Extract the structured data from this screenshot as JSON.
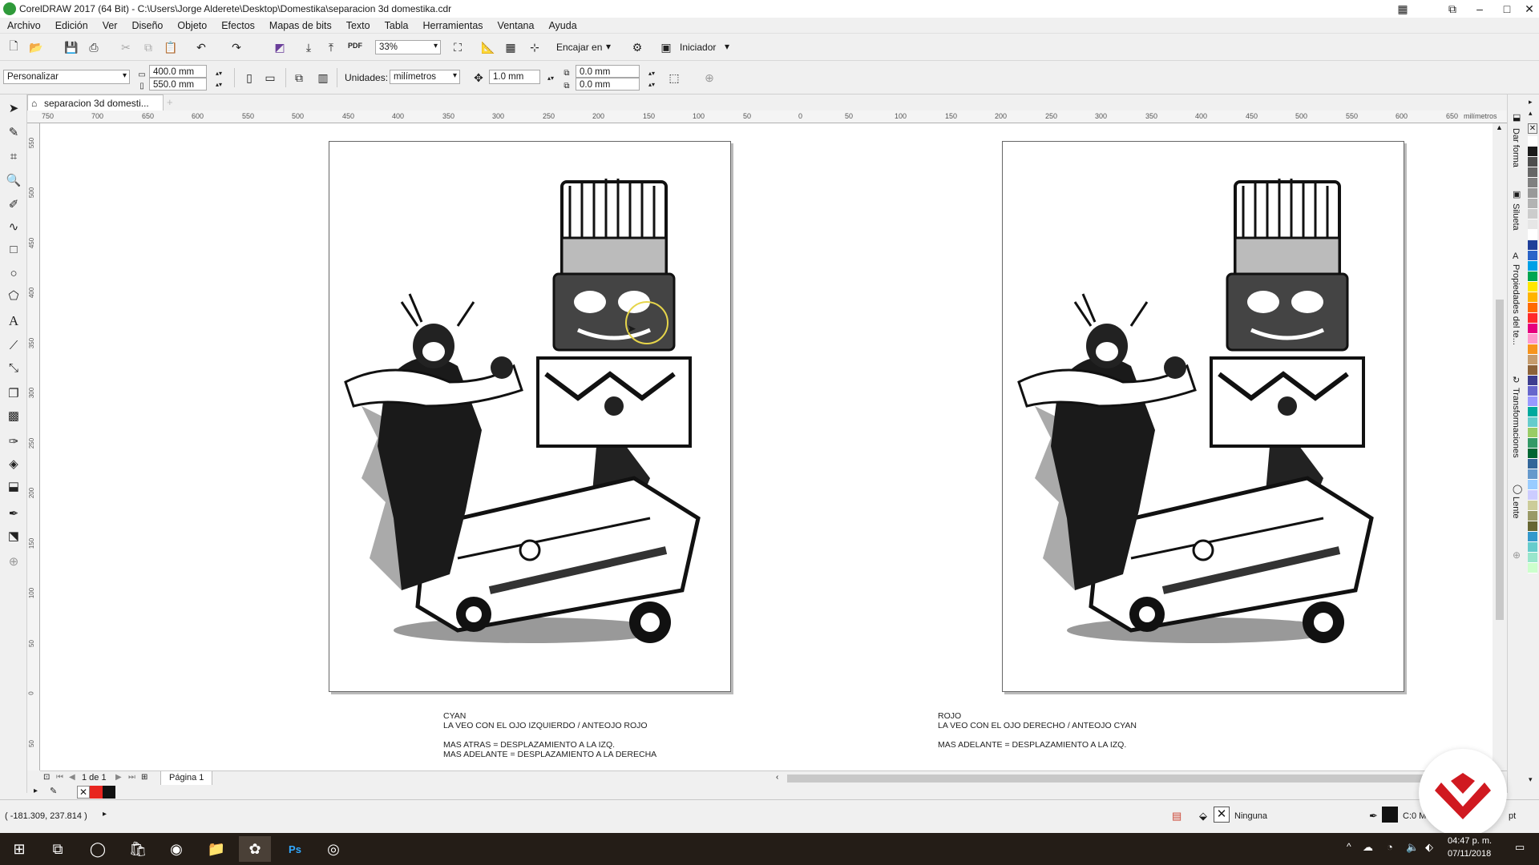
{
  "window": {
    "title": "CorelDRAW 2017 (64 Bit) - C:\\Users\\Jorge Alderete\\Desktop\\Domestika\\separacion 3d domestika.cdr"
  },
  "menu": [
    "Archivo",
    "Edición",
    "Ver",
    "Diseño",
    "Objeto",
    "Efectos",
    "Mapas de bits",
    "Texto",
    "Tabla",
    "Herramientas",
    "Ventana",
    "Ayuda"
  ],
  "toolbar1": {
    "zoom": "33%",
    "snap_label": "Encajar en",
    "launcher_label": "Iniciador",
    "pdf_label": "PDF"
  },
  "toolbar2": {
    "preset": "Personalizar",
    "width": "400.0 mm",
    "height": "550.0 mm",
    "units_label": "Unidades:",
    "units_value": "milímetros",
    "nudge": "1.0 mm",
    "dup_x": "0.0 mm",
    "dup_y": "0.0 mm"
  },
  "document_tab": "separacion 3d domesti...",
  "ruler_h": {
    "labels": [
      "750",
      "700",
      "650",
      "600",
      "550",
      "500",
      "450",
      "400",
      "350",
      "300",
      "250",
      "200",
      "150",
      "100",
      "50",
      "0",
      "50",
      "100",
      "150",
      "200",
      "250",
      "300",
      "350",
      "400",
      "450",
      "500",
      "550",
      "600",
      "650"
    ],
    "unit": "milímetros"
  },
  "ruler_v": {
    "labels": [
      "550",
      "500",
      "450",
      "400",
      "350",
      "300",
      "250",
      "200",
      "150",
      "100",
      "50",
      "0",
      "50"
    ]
  },
  "captions": {
    "left": {
      "line1": "CYAN",
      "line2": "LA VEO CON EL OJO IZQUIERDO / ANTEOJO ROJO",
      "line3": "MAS ATRAS = DESPLAZAMIENTO A LA IZQ.",
      "line4": "MAS ADELANTE = DESPLAZAMIENTO A LA DERECHA"
    },
    "right": {
      "line1": "ROJO",
      "line2": "LA VEO CON EL OJO DERECHO / ANTEOJO CYAN",
      "line3": "MAS ADELANTE = DESPLAZAMIENTO A LA IZQ."
    }
  },
  "pager": {
    "page_of": "1 de 1",
    "page_tab": "Página 1"
  },
  "dockers": [
    "Dar forma",
    "Silueta",
    "Propiedades del te...",
    "Transformaciones",
    "Lente"
  ],
  "palette": [
    "#ffffff",
    "#1a1a1a",
    "#4d4d4d",
    "#666666",
    "#808080",
    "#999999",
    "#b3b3b3",
    "#cccccc",
    "#e6e6e6",
    "#ffffff",
    "#1f3f99",
    "#2a64c8",
    "#00a0e6",
    "#00a651",
    "#ffe600",
    "#ffb300",
    "#ff6a00",
    "#ff2a2a",
    "#e6007e",
    "#ff99cc",
    "#f7941d",
    "#c69c6d",
    "#8c6239",
    "#3d3d8f",
    "#6666cc",
    "#9999ff",
    "#00a99d",
    "#66cccc",
    "#99cc66",
    "#339966",
    "#006633",
    "#336699",
    "#6699cc",
    "#99ccff",
    "#ccccff",
    "#cccc99",
    "#999966",
    "#666633",
    "#3399cc",
    "#66cccc",
    "#99e6cc",
    "#ccffcc"
  ],
  "statusbar": {
    "coords": "( -181.309, 237.814 )",
    "fill": "Ninguna",
    "color_info": "C:0 M",
    "unit_tail": "pt"
  },
  "taskbar": {
    "time": "04:47 p. m.",
    "date": "07/11/2018"
  },
  "colors": {
    "app_icon": "#2f9a3a",
    "taskbar": "#241d17",
    "brand_red": "#d01920"
  }
}
